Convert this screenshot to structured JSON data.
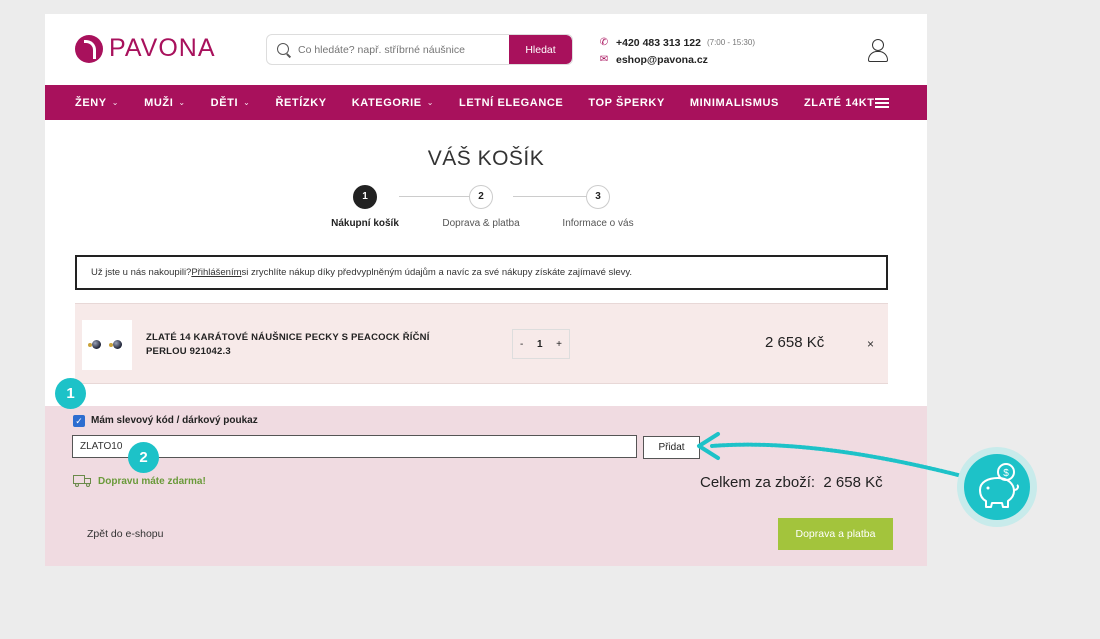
{
  "header": {
    "logo_text": "PAVONA",
    "search_placeholder": "Co hledáte? např. stříbrné náušnice",
    "search_button": "Hledat",
    "phone": "+420 483 313 122",
    "hours": "(7:00 - 15:30)",
    "email": "eshop@pavona.cz"
  },
  "nav": {
    "items": [
      {
        "label": "ŽENY",
        "dropdown": true
      },
      {
        "label": "MUŽI",
        "dropdown": true
      },
      {
        "label": "DĚTI",
        "dropdown": true
      },
      {
        "label": "ŘETÍZKY",
        "dropdown": false
      },
      {
        "label": "KATEGORIE",
        "dropdown": true
      },
      {
        "label": "LETNÍ ELEGANCE",
        "dropdown": false
      },
      {
        "label": "TOP ŠPERKY",
        "dropdown": false
      },
      {
        "label": "MINIMALISMUS",
        "dropdown": false
      },
      {
        "label": "ZLATÉ 14KT",
        "dropdown": false
      }
    ]
  },
  "cart": {
    "title": "VÁŠ KOŠÍK",
    "steps": [
      {
        "number": "1",
        "label": "Nákupní košík",
        "active": true
      },
      {
        "number": "2",
        "label": "Doprava & platba",
        "active": false
      },
      {
        "number": "3",
        "label": "Informace o vás",
        "active": false
      }
    ],
    "login_text_before": "Už jste u nás nakoupili? ",
    "login_link": "Přihlášením",
    "login_text_after": " si zrychlíte nákup díky předvyplněným údajům a navíc za své nákupy získáte zajímavé slevy.",
    "item": {
      "name": "ZLATÉ 14 KARÁTOVÉ NÁUŠNICE PECKY S PEACOCK ŘÍČNÍ PERLOU 921042.3",
      "qty_minus": "-",
      "qty": "1",
      "qty_plus": "+",
      "price": "2 658 Kč",
      "remove": "×"
    },
    "coupon": {
      "checkbox_label": "Mám slevový kód / dárkový poukaz",
      "checked": true,
      "code_value": "ZLATO10",
      "add_button": "Přidat"
    },
    "free_shipping": "Dopravu máte zdarma!",
    "total_label": "Celkem za zboží:",
    "total_value": "2 658 Kč",
    "back_link": "Zpět do e-shopu",
    "next_button": "Doprava a platba"
  },
  "annotations": {
    "badge1": "1",
    "badge2": "2",
    "accent_color": "#1dc2c8",
    "brand_color": "#a8115c"
  },
  "icons": [
    "search-icon",
    "phone-icon",
    "mail-icon",
    "user-icon",
    "hamburger-icon",
    "chevron-down-icon",
    "truck-icon",
    "piggy-bank-icon",
    "close-icon",
    "checkbox-icon"
  ]
}
